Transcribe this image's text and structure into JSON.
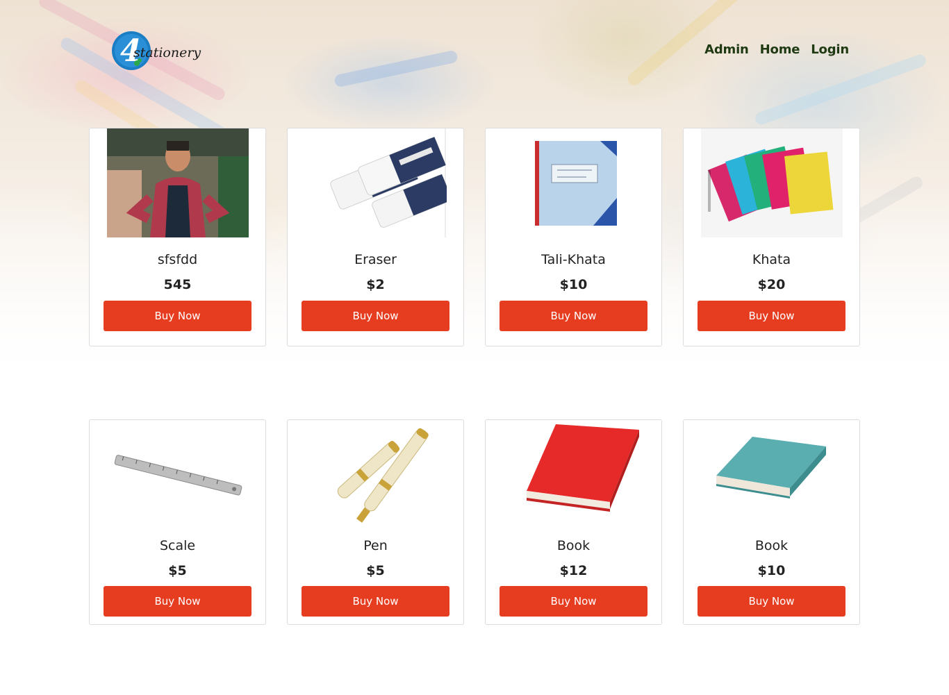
{
  "brand": {
    "logo_letter": "4",
    "logo_text": "stationery"
  },
  "nav": [
    {
      "label": "Admin"
    },
    {
      "label": "Home"
    },
    {
      "label": "Login"
    }
  ],
  "products": [
    {
      "name": "sfsfdd",
      "price": "545",
      "button": "Buy Now",
      "image": "meme-photo"
    },
    {
      "name": "Eraser",
      "price": "$2",
      "button": "Buy Now",
      "image": "eraser"
    },
    {
      "name": "Tali-Khata",
      "price": "$10",
      "button": "Buy Now",
      "image": "notebook-blue"
    },
    {
      "name": "Khata",
      "price": "$20",
      "button": "Buy Now",
      "image": "notebooks-colorful"
    },
    {
      "name": "Scale",
      "price": "$5",
      "button": "Buy Now",
      "image": "ruler"
    },
    {
      "name": "Pen",
      "price": "$5",
      "button": "Buy Now",
      "image": "fountain-pen"
    },
    {
      "name": "Book",
      "price": "$12",
      "button": "Buy Now",
      "image": "book-red"
    },
    {
      "name": "Book",
      "price": "$10",
      "button": "Buy Now",
      "image": "book-teal"
    }
  ],
  "colors": {
    "button": "#e63d21",
    "nav_text": "#1f3a12",
    "logo_blue": "#1b7ec4"
  }
}
